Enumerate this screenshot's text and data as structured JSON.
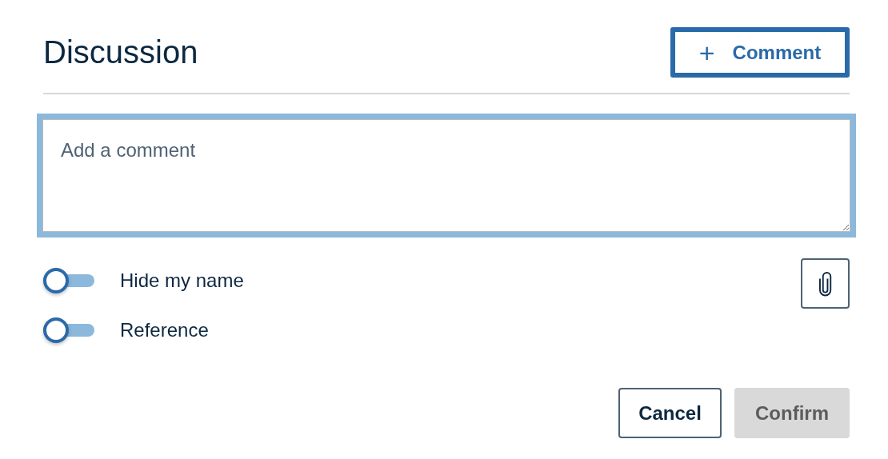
{
  "title": "Discussion",
  "add_button": {
    "icon": "+",
    "label": "Comment"
  },
  "comment_field": {
    "placeholder": "Add a comment"
  },
  "toggles": [
    {
      "label": "Hide my name",
      "on": false
    },
    {
      "label": "Reference",
      "on": false
    }
  ],
  "actions": [
    {
      "label": "Cancel",
      "disabled": false
    },
    {
      "label": "Confirm",
      "disabled": true
    }
  ]
}
